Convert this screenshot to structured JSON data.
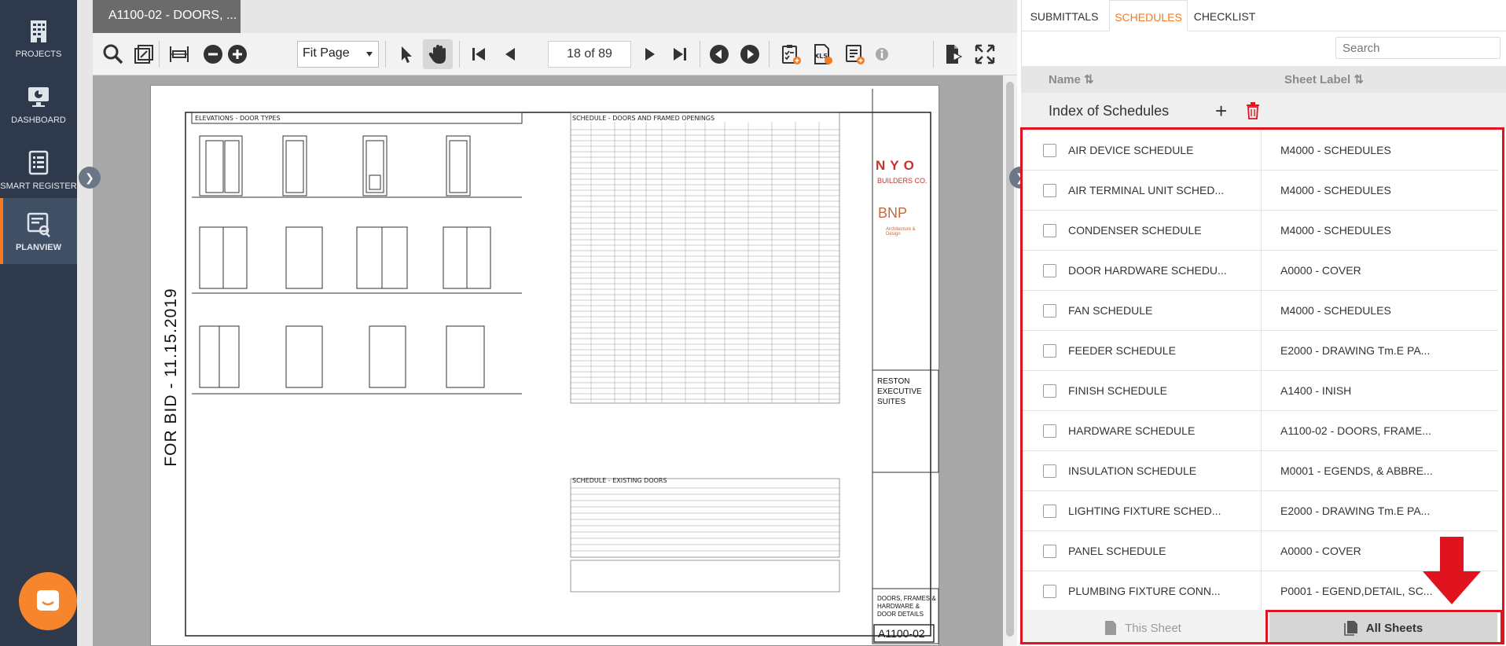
{
  "nav": {
    "items": [
      {
        "label": "PROJECTS",
        "icon": "building-icon"
      },
      {
        "label": "DASHBOARD",
        "icon": "dashboard-icon"
      },
      {
        "label": "SMART REGISTER",
        "icon": "register-icon"
      },
      {
        "label": "PLANVIEW",
        "icon": "planview-icon"
      }
    ]
  },
  "viewer": {
    "doc_tab": "A1100-02 - DOORS, ...",
    "zoom_value": "Fit Page",
    "page_value": "18 of 89"
  },
  "drawing": {
    "stamp": "FOR BID - 11.15.2019",
    "elevations_title": "ELEVATIONS - DOOR TYPES",
    "schedule_title": "SCHEDULE - DOORS AND FRAMED OPENINGS",
    "existing_title": "SCHEDULE - EXISTING DOORS",
    "logo_nyo": "NYO",
    "logo_builders": "BUILDERS CO.",
    "logo_bnp": "BNP",
    "logo_bnp_sub": "Architecture & Design",
    "project_name": "RESTON EXECUTIVE SUITES",
    "sheet_title": "DOORS, FRAMES & HARDWARE & DOOR DETAILS",
    "sheet_number": "A1100-02"
  },
  "panel": {
    "tabs": [
      "SUBMITTALS",
      "SCHEDULES",
      "CHECKLIST"
    ],
    "active_tab": "SCHEDULES",
    "search_placeholder": "Search",
    "col_name": "Name ⇅",
    "col_label": "Sheet Label ⇅",
    "index_title": "Index of Schedules",
    "rows": [
      {
        "name": "AIR DEVICE SCHEDULE",
        "label": "M4000 - SCHEDULES"
      },
      {
        "name": "AIR TERMINAL UNIT SCHED...",
        "label": "M4000 - SCHEDULES"
      },
      {
        "name": "CONDENSER SCHEDULE",
        "label": "M4000 - SCHEDULES"
      },
      {
        "name": "DOOR HARDWARE SCHEDU...",
        "label": "A0000 - COVER"
      },
      {
        "name": "FAN SCHEDULE",
        "label": "M4000 - SCHEDULES"
      },
      {
        "name": "FEEDER SCHEDULE",
        "label": "E2000 - DRAWING Tm.E PA..."
      },
      {
        "name": "FINISH SCHEDULE",
        "label": "A1400 - INISH"
      },
      {
        "name": "HARDWARE SCHEDULE",
        "label": "A1100-02 - DOORS, FRAME..."
      },
      {
        "name": "INSULATION SCHEDULE",
        "label": "M0001 - EGENDS, & ABBRE..."
      },
      {
        "name": "LIGHTING FIXTURE SCHED...",
        "label": "E2000 - DRAWING Tm.E PA..."
      },
      {
        "name": "PANEL SCHEDULE",
        "label": "A0000 - COVER"
      },
      {
        "name": "PLUMBING FIXTURE CONN...",
        "label": "P0001 - EGEND,DETAIL, SC..."
      }
    ],
    "btn_this_sheet": "This Sheet",
    "btn_all_sheets": "All Sheets"
  },
  "colors": {
    "accent": "#f47a22",
    "nav_bg": "#2e3a4b",
    "highlight_red": "#e0141e"
  }
}
